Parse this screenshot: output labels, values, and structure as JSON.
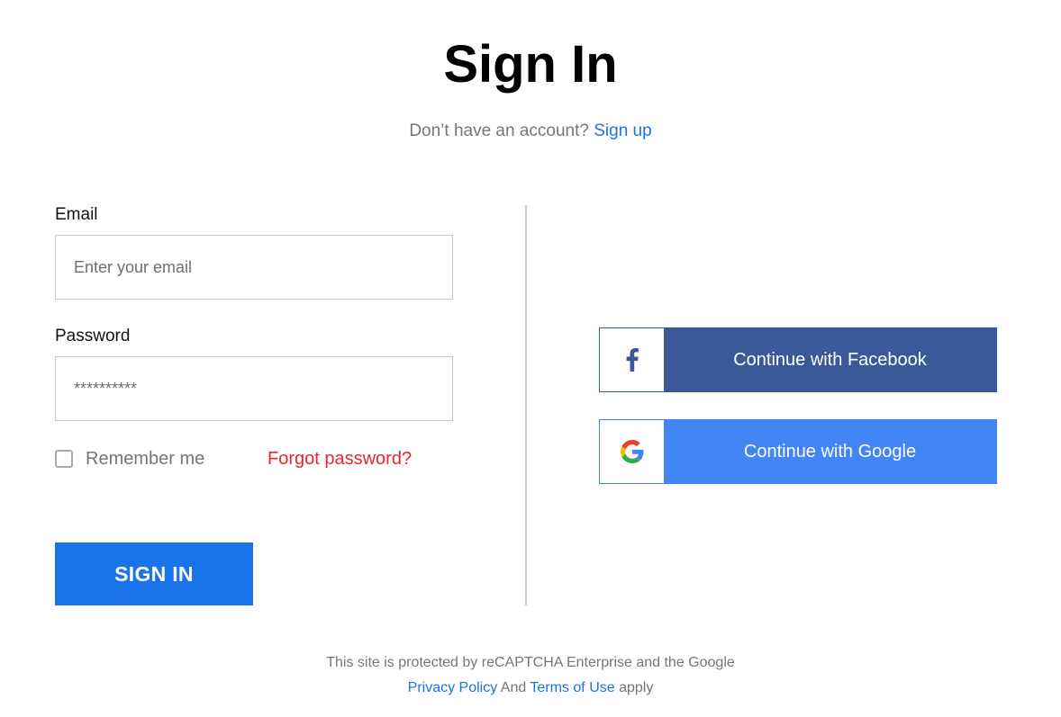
{
  "header": {
    "title": "Sign In",
    "signup_prompt": "Don’t have an account?",
    "signup_link": "Sign up"
  },
  "form": {
    "email_label": "Email",
    "email_placeholder": "Enter your email",
    "password_label": "Password",
    "password_placeholder": "**********",
    "remember_label": "Remember me",
    "remember_checked": false,
    "forgot_link": "Forgot password?",
    "submit_label": "SIGN IN"
  },
  "social": {
    "facebook_label": "Continue with Facebook",
    "google_label": "Continue with Google"
  },
  "footer": {
    "line1": "This site is protected by reCAPTCHA Enterprise and the Google",
    "privacy_link": "Privacy Policy",
    "and_text": "And",
    "terms_link": "Terms of Use",
    "apply_text": "apply"
  },
  "colors": {
    "primary": "#1a73e8",
    "facebook": "#3b5998",
    "google": "#4285f4",
    "forgot": "#e8262b"
  }
}
